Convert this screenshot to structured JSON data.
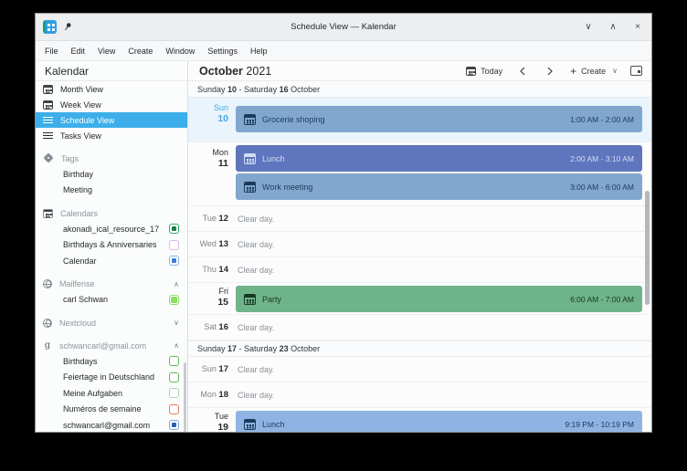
{
  "icons": {
    "chevron_up": "∧",
    "chevron_down": "∨",
    "close": "×",
    "plus": "+",
    "google": "g",
    "prev": "‹",
    "next": "›"
  },
  "titlebar": {
    "title": "Schedule View — Kalendar"
  },
  "menubar": {
    "items": [
      "File",
      "Edit",
      "View",
      "Create",
      "Window",
      "Settings",
      "Help"
    ]
  },
  "sidebar": {
    "app_title": "Kalendar",
    "views": [
      {
        "label": "Month View"
      },
      {
        "label": "Week View"
      },
      {
        "label": "Schedule View",
        "selected": true
      },
      {
        "label": "Tasks View"
      }
    ],
    "tags": {
      "header": "Tags",
      "items": [
        {
          "label": "Birthday"
        },
        {
          "label": "Meeting"
        }
      ]
    },
    "calendars": {
      "header": "Calendars",
      "items": [
        {
          "label": "akonadi_ical_resource_17",
          "checked": true,
          "color": "#1c7f47"
        },
        {
          "label": "Birthdays & Anniversaries",
          "checked": false,
          "color": "#dfb8ec"
        },
        {
          "label": "Calendar",
          "checked": true,
          "color": "#3f7ed2"
        }
      ]
    },
    "accounts": [
      {
        "header": "Mailfense",
        "expanded": true,
        "items": [
          {
            "label": "carl Schwan",
            "checked": true,
            "color": "#8be05e"
          }
        ]
      },
      {
        "header": "Nextcloud",
        "expanded": false,
        "items": []
      },
      {
        "header": "schwancarl@gmail.com",
        "expanded": true,
        "items": [
          {
            "label": "Birthdays",
            "checked": false,
            "color": "#63b75e"
          },
          {
            "label": "Feiertage in Deutschland",
            "checked": false,
            "color": "#63b75e"
          },
          {
            "label": "Meine Aufgaben",
            "checked": false,
            "color": "#a9d6a2"
          },
          {
            "label": "Numéros de semaine",
            "checked": false,
            "color": "#e87b64"
          },
          {
            "label": "schwancarl@gmail.com",
            "checked": true,
            "color": "#2a5fb8"
          }
        ]
      }
    ]
  },
  "toolbar": {
    "month": "October",
    "year": "2021",
    "today_label": "Today",
    "create_label": "Create"
  },
  "schedule": {
    "week1_header": {
      "day1": "Sunday ",
      "num1": "10",
      "sep": " - Saturday ",
      "num2": "16",
      "month": " October"
    },
    "week2_header": {
      "day1": "Sunday ",
      "num1": "17",
      "sep": " - Saturday ",
      "num2": "23",
      "month": " October"
    },
    "clear_text": "Clear day.",
    "rows": [
      {
        "day": "Sun",
        "num": "10",
        "today": true,
        "events": [
          {
            "title": "Grocerie shoping",
            "time": "1:00 AM - 2:00 AM",
            "color": "#82a7cf"
          }
        ]
      },
      {
        "day": "Mon",
        "num": "11",
        "events": [
          {
            "title": "Lunch",
            "time": "2:00 AM - 3:10 AM",
            "color": "#5f75bd"
          },
          {
            "title": "Work meeting",
            "time": "3:00 AM - 6:00 AM",
            "color": "#82a7cf"
          }
        ]
      },
      {
        "day": "Tue",
        "num": "12"
      },
      {
        "day": "Wed",
        "num": "13"
      },
      {
        "day": "Thu",
        "num": "14"
      },
      {
        "day": "Fri",
        "num": "15",
        "events": [
          {
            "title": "Party",
            "time": "6:00 AM - 7:00 AM",
            "color": "#6fb489"
          }
        ]
      },
      {
        "day": "Sat",
        "num": "16"
      },
      {
        "day": "Sun",
        "num": "17"
      },
      {
        "day": "Mon",
        "num": "18"
      },
      {
        "day": "Tue",
        "num": "19",
        "events": [
          {
            "title": "Lunch",
            "time": "9:19 PM - 10:19 PM",
            "color": "#8fb4e3"
          }
        ]
      }
    ]
  },
  "colors": {
    "accent": "#3daee9",
    "today_row": "#e9f4fc",
    "today_text": "#43a7e0",
    "event_blue": "#82a7cf",
    "event_indigo": "#5f75bd",
    "event_green": "#6fb489",
    "event_lightblue": "#8fb4e3"
  }
}
